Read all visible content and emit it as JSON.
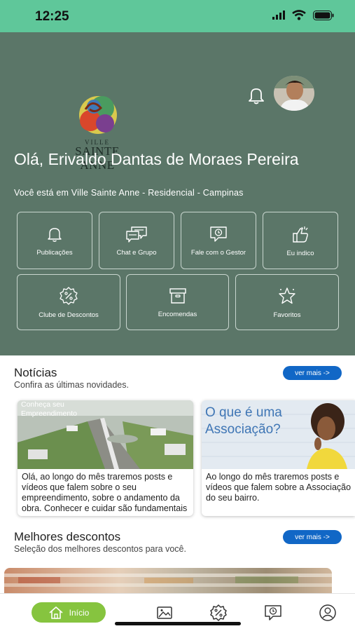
{
  "status_bar": {
    "time": "12:25"
  },
  "header": {
    "logo_line_1": "VILLE",
    "logo_line_2": "SAINTE ANNE",
    "greeting": "Olá, Erivaldo Dantas de Moraes Pereira",
    "location": "Você está em Ville Sainte Anne - Residencial - Campinas"
  },
  "tiles": [
    {
      "label": "Publicações",
      "icon": "bell-icon"
    },
    {
      "label": "Chat e Grupo",
      "icon": "chat-icon"
    },
    {
      "label": "Fale com o Gestor",
      "icon": "manager-chat-icon"
    },
    {
      "label": "Eu indico",
      "icon": "thumbs-up-icon"
    },
    {
      "label": "Clube de Descontos",
      "icon": "discount-badge-icon"
    },
    {
      "label": "Encomendas",
      "icon": "package-box-icon"
    },
    {
      "label": "Favoritos",
      "icon": "star-icon"
    }
  ],
  "news": {
    "title": "Notícias",
    "subtitle": "Confira as últimas novidades.",
    "more_label": "ver mais ->",
    "cards": [
      {
        "image_caption": "Conheça seu Empreendimento",
        "text": "Olá, ao longo do mês traremos posts e vídeos que falem sobre o seu empreendimento, sobre o andamento da obra. Conhecer e cuidar são fundamentais para o"
      },
      {
        "image_caption": "O que é uma Associação?",
        "text": "Ao longo do mês traremos posts e vídeos que falem sobre  a Associação do seu bairro."
      }
    ]
  },
  "discounts": {
    "title": "Melhores descontos",
    "subtitle": "Seleção dos melhores descontos para você.",
    "more_label": "ver mais ->"
  },
  "tab_bar": {
    "home_label": "Início",
    "tabs": [
      "home-icon",
      "gallery-icon",
      "discount-icon",
      "manager-icon",
      "profile-icon"
    ]
  },
  "colors": {
    "status_bar": "#5fc79a",
    "hero_background": "#5b7668",
    "accent_blue": "#1167c6",
    "tab_active": "#86c43f"
  }
}
